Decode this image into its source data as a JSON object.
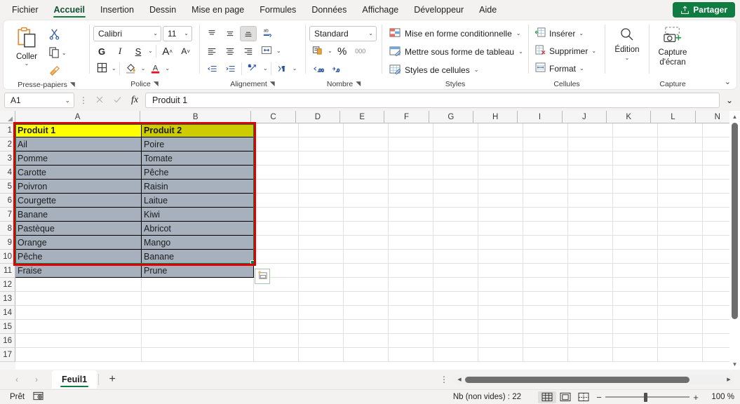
{
  "window": {
    "ribbon_tabs": [
      {
        "label": "Fichier",
        "active": false
      },
      {
        "label": "Accueil",
        "active": true
      },
      {
        "label": "Insertion",
        "active": false
      },
      {
        "label": "Dessin",
        "active": false
      },
      {
        "label": "Mise en page",
        "active": false
      },
      {
        "label": "Formules",
        "active": false
      },
      {
        "label": "Données",
        "active": false
      },
      {
        "label": "Affichage",
        "active": false
      },
      {
        "label": "Développeur",
        "active": false
      },
      {
        "label": "Aide",
        "active": false
      }
    ],
    "share_label": "Partager"
  },
  "ribbon": {
    "clipboard": {
      "group_title": "Presse-papiers",
      "paste_label": "Coller",
      "cut_name": "cut-icon",
      "copy_name": "copy-icon",
      "format_painter_name": "format-painter-icon"
    },
    "font": {
      "group_title": "Police",
      "font_name": "Calibri",
      "font_size": "11",
      "bold_label": "G",
      "italic_label": "I",
      "underline_label": "S",
      "grow_label": "A",
      "shrink_label": "A",
      "borders_name": "borders-icon",
      "fill_color_label": "A",
      "font_color_label": "A"
    },
    "alignment": {
      "group_title": "Alignement",
      "wrap_label": "ab",
      "merge_name": "merge-cells-icon",
      "orientation_name": "orientation-icon",
      "indent_name": "indent-icon"
    },
    "number": {
      "group_title": "Nombre",
      "format": "Standard",
      "percent_label": "%",
      "thousands_label": "000",
      "inc_dec_label": ".00",
      "dec_dec_label": ".0"
    },
    "styles": {
      "group_title": "Styles",
      "items": [
        {
          "label": "Mise en forme conditionnelle",
          "icon": "conditional-formatting-icon"
        },
        {
          "label": "Mettre sous forme de tableau",
          "icon": "format-as-table-icon"
        },
        {
          "label": "Styles de cellules",
          "icon": "cell-styles-icon"
        }
      ]
    },
    "cells": {
      "group_title": "Cellules",
      "items": [
        {
          "label": "Insérer",
          "icon": "insert-cells-icon"
        },
        {
          "label": "Supprimer",
          "icon": "delete-cells-icon"
        },
        {
          "label": "Format",
          "icon": "format-cells-icon"
        }
      ]
    },
    "editing": {
      "group_title": "",
      "label": "Édition",
      "icon": "magnifier-icon"
    },
    "capture": {
      "group_title": "Capture",
      "label_line1": "Capture",
      "label_line2": "d'écran",
      "icon": "screenshot-camera-icon"
    }
  },
  "formula_bar": {
    "name_box": "A1",
    "cancel_name": "cancel-icon",
    "enter_name": "confirm-icon",
    "fx_label": "fx",
    "formula_value": "Produit 1"
  },
  "grid": {
    "columns": [
      "A",
      "B",
      "C",
      "D",
      "E",
      "F",
      "G",
      "H",
      "I",
      "J",
      "K",
      "L",
      "N"
    ],
    "rows": [
      "1",
      "2",
      "3",
      "4",
      "5",
      "6",
      "7",
      "8",
      "9",
      "10",
      "11",
      "12",
      "13",
      "14",
      "15",
      "16",
      "17"
    ],
    "table": {
      "header": [
        "Produit 1",
        "Produit 2"
      ],
      "rows": [
        [
          "Ail",
          "Poire"
        ],
        [
          "Pomme",
          "Tomate"
        ],
        [
          "Carotte",
          "Pêche"
        ],
        [
          "Poivron",
          "Raisin"
        ],
        [
          "Courgette",
          "Laitue"
        ],
        [
          "Banane",
          "Kiwi"
        ],
        [
          "Pastèque",
          "Abricot"
        ],
        [
          "Orange",
          "Mango"
        ],
        [
          "Pêche",
          "Banane"
        ],
        [
          "Fraise",
          "Prune"
        ]
      ]
    },
    "colors": {
      "active_cell_fill": "#FFFF00",
      "selected_header_fill": "#CCCC00",
      "selection_fill": "#A7B0BD",
      "selection_border": "#0B7C47",
      "annotation_border": "#E00000"
    },
    "paste_tag_name": "paste-options-icon"
  },
  "sheet_bar": {
    "prev_name": "prev-sheet-icon",
    "next_name": "next-sheet-icon",
    "tabs": [
      {
        "label": "Feuil1",
        "active": true
      }
    ],
    "add_label": "+",
    "menu_label": "⋮"
  },
  "status_bar": {
    "state": "Prêt",
    "accessibility_name": "accessibility-checker-icon",
    "count_label": "Nb (non vides) : 22",
    "views": [
      {
        "name": "normal-view-icon",
        "active": true
      },
      {
        "name": "page-layout-view-icon",
        "active": false
      },
      {
        "name": "page-break-view-icon",
        "active": false
      }
    ],
    "zoom_out": "−",
    "zoom_in": "+",
    "zoom_level": "100 %"
  }
}
